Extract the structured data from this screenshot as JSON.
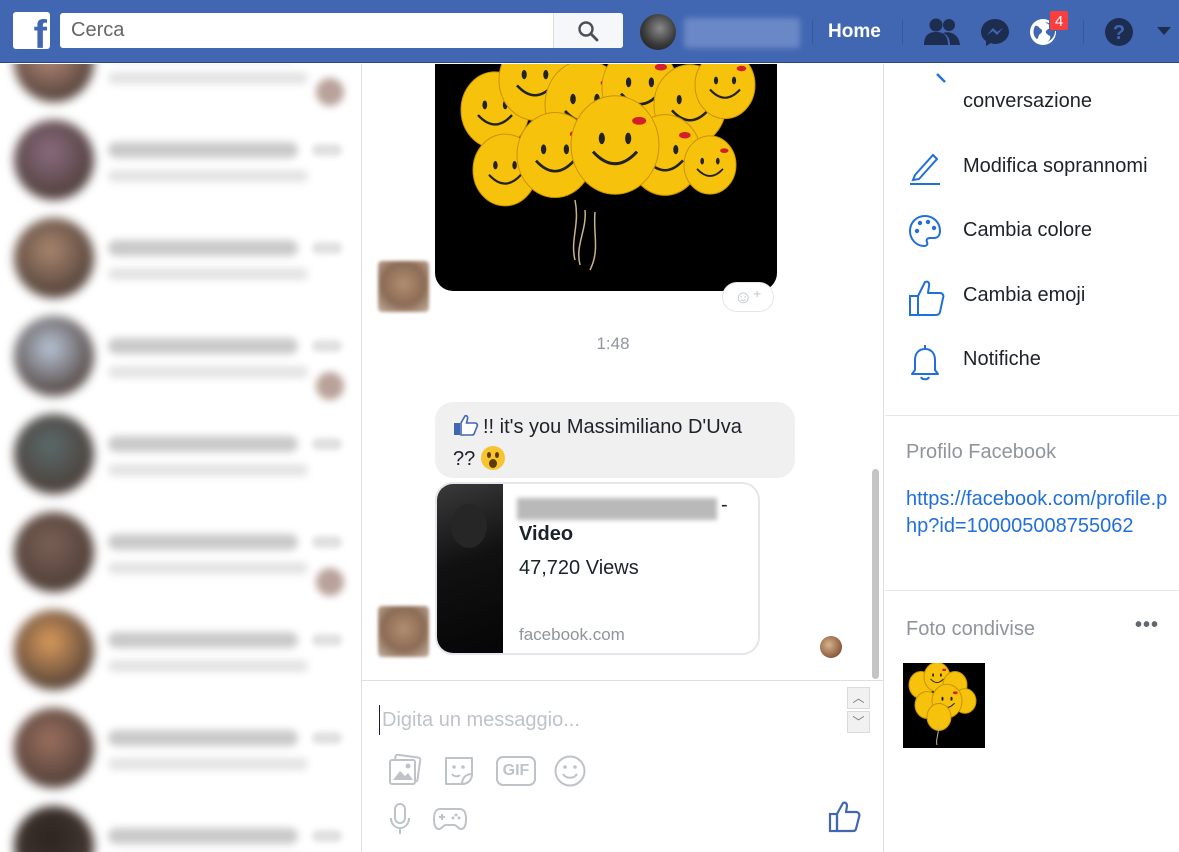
{
  "topbar": {
    "logo_letter": "f",
    "search_placeholder": "Cerca",
    "home_label": "Home",
    "notifications_badge": "4",
    "brand_color": "#4267b2"
  },
  "conversation_list": {
    "avatar_colors": [
      "#b98c7a",
      "#8a6b7e",
      "#a9866e",
      "#b8c4d6",
      "#5a6a6a",
      "#7a6055",
      "#d99a5c",
      "#9a6f5e",
      "#2a2420"
    ]
  },
  "chat": {
    "timestamp": "1:48",
    "message_text_line1": "!! it's you Massimiliano D'Uva",
    "message_text_line2": "??",
    "link_title": "Video",
    "link_dash": "-",
    "link_views": "47,720 Views",
    "link_domain": "facebook.com",
    "composer_placeholder": "Digita un messaggio...",
    "gif_label": "GIF",
    "icons": [
      "photo-icon",
      "sticker-icon",
      "gif-icon",
      "emoji-icon",
      "microphone-icon",
      "game-controller-icon",
      "like-icon"
    ]
  },
  "details": {
    "options": [
      {
        "label": "conversazione",
        "icon": "search-icon"
      },
      {
        "label": "Modifica soprannomi",
        "icon": "pencil-icon"
      },
      {
        "label": "Cambia colore",
        "icon": "palette-icon"
      },
      {
        "label": "Cambia emoji",
        "icon": "thumbs-up-icon"
      },
      {
        "label": "Notifiche",
        "icon": "bell-icon"
      }
    ],
    "profile_section_title": "Profilo Facebook",
    "profile_url": "https://facebook.com/profile.php?id=100005008755062",
    "shared_photos_title": "Foto condivise",
    "more_label": "•••",
    "accent_color": "#216fdb"
  }
}
